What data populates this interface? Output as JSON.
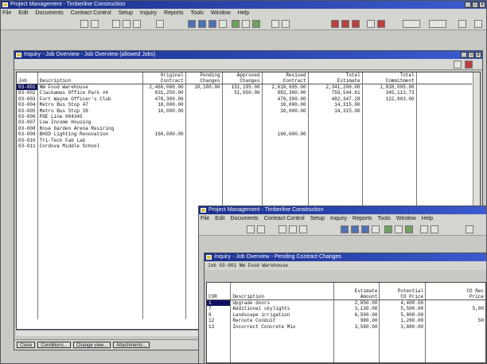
{
  "app": {
    "title": "Project Management - Timberline Construction",
    "menu": [
      "File",
      "Edit",
      "Documents",
      "Contract Control",
      "Setup",
      "Inquiry",
      "Reports",
      "Tools",
      "Window",
      "Help"
    ],
    "window_buttons": [
      "_",
      "□",
      "x"
    ]
  },
  "overview": {
    "title": "Inquiry - Job Overview - Job Overview (allowed Jobs)",
    "headers": [
      [
        "",
        "Job"
      ],
      [
        "",
        "Description"
      ],
      [
        "Original",
        "Contract"
      ],
      [
        "Pending",
        "Changes"
      ],
      [
        "Approved",
        "Changes"
      ],
      [
        "Revised",
        "Contract"
      ],
      [
        "Total",
        "Estimate"
      ],
      [
        "Total",
        "Commitment"
      ]
    ],
    "rows": [
      [
        "03-001",
        "NW Food Warehouse",
        "2,460,000.00",
        "10,100.00",
        "151,195.00",
        "2,610,695.00",
        "2,341,200.00",
        "1,838,095.00"
      ],
      [
        "03-002",
        "Clackamas Office Park #4",
        "831,250.00",
        "",
        "51,050.00",
        "882,300.00",
        "759,544.61",
        "345,113.73"
      ],
      [
        "03-003",
        "Fort Wayne Officer's Club",
        "478,300.00",
        "",
        "",
        "478,300.00",
        "482,347.28",
        "122,803.00"
      ],
      [
        "03-004",
        "Metro Bus Stop 47",
        "10,000.00",
        "",
        "",
        "10,000.00",
        "14,315.00",
        ""
      ],
      [
        "03-005",
        "Metro Bus Stop 39",
        "10,000.00",
        "",
        "",
        "10,000.00",
        "14,315.00",
        ""
      ],
      [
        "03-006",
        "PGE Line 004345",
        "",
        "",
        "",
        "",
        "",
        ""
      ],
      [
        "03-007",
        "Low Income Housing",
        "",
        "",
        "",
        "",
        "",
        ""
      ],
      [
        "03-008",
        "Rose Garden Arena Resiring",
        "",
        "",
        "",
        "",
        "",
        ""
      ],
      [
        "03-009",
        "BHSD Lighting Renovation",
        "160,000.00",
        "",
        "",
        "160,000.00",
        "",
        ""
      ],
      [
        "03-010",
        "Tri-Tech Fab Lab",
        "",
        "",
        "",
        "",
        "",
        ""
      ],
      [
        "03-011",
        "Cordova Middle School",
        "",
        "",
        "",
        "",
        "",
        ""
      ]
    ],
    "buttons": [
      "Close",
      "Conditions...",
      "Change view...",
      "Attachments..."
    ]
  },
  "pcc": {
    "title": "Inquiry - Job Overview - Pending Contract Changes",
    "job_label": "Job",
    "job_value": "03-001 NW Food Warehouse",
    "headers": [
      [
        "",
        "",
        "COR"
      ],
      [
        "",
        "",
        "Description"
      ],
      [
        "",
        "Estimate",
        "Amount"
      ],
      [
        "",
        "Potential",
        "CO Price"
      ],
      [
        "",
        "CO Rec",
        "Price"
      ]
    ],
    "rows": [
      [
        "1",
        "Upgrade doors",
        "2,850.00",
        "4,400.00",
        ""
      ],
      [
        "7",
        "Additional skylights",
        "3,130.00",
        "5,500.00",
        "5,00"
      ],
      [
        "8",
        "Landscape irrigation",
        "6,500.00",
        "5,800.00",
        ""
      ],
      [
        "12",
        "Reroute Conduit",
        "980.00",
        "1,280.00",
        "50"
      ],
      [
        "13",
        "Incorrect Concrete Mix",
        "3,580.00",
        "3,880.00",
        ""
      ]
    ]
  }
}
